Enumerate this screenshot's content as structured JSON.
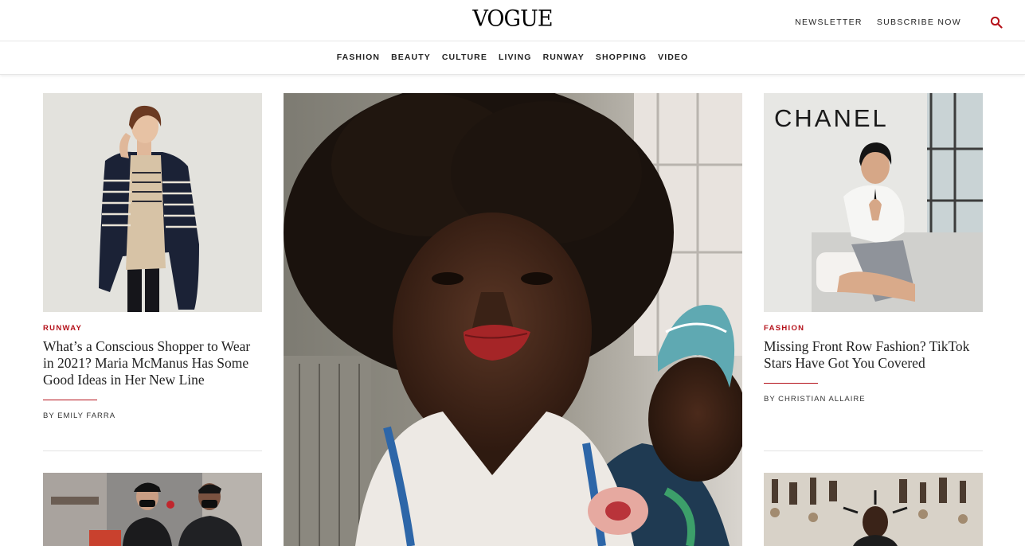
{
  "header": {
    "logo": "VOGUE",
    "newsletter_label": "NEWSLETTER",
    "subscribe_label": "SUBSCRIBE NOW",
    "accent_color": "#b5121b"
  },
  "nav": {
    "items": [
      "FASHION",
      "BEAUTY",
      "CULTURE",
      "LIVING",
      "RUNWAY",
      "SHOPPING",
      "VIDEO"
    ]
  },
  "left_card": {
    "tag": "RUNWAY",
    "headline": "What’s a Conscious Shopper to Wear in 2021? Maria McManus Has Some Good Ideas in Her New Line",
    "byline": "BY EMILY FARRA"
  },
  "right_card": {
    "tag": "FASHION",
    "headline": "Missing Front Row Fashion? TikTok Stars Have Got You Covered",
    "byline": "BY CHRISTIAN ALLAIRE",
    "image_sign": "CHANEL"
  },
  "icons": {
    "search": "search-icon"
  }
}
